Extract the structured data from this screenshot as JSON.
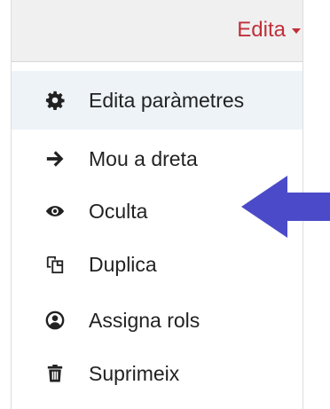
{
  "header": {
    "edit_label": "Edita"
  },
  "menu": {
    "items": [
      {
        "label": "Edita paràmetres",
        "icon": "gear-icon"
      },
      {
        "label": "Mou a dreta",
        "icon": "arrow-right-icon"
      },
      {
        "label": "Oculta",
        "icon": "eye-icon"
      },
      {
        "label": "Duplica",
        "icon": "duplicate-icon"
      },
      {
        "label": "Assigna rols",
        "icon": "user-circle-icon"
      },
      {
        "label": "Suprimeix",
        "icon": "trash-icon"
      }
    ]
  },
  "colors": {
    "edit_accent": "#c0303a",
    "annotation_arrow": "#4b4bc9",
    "active_item_bg": "#eef3f8"
  }
}
